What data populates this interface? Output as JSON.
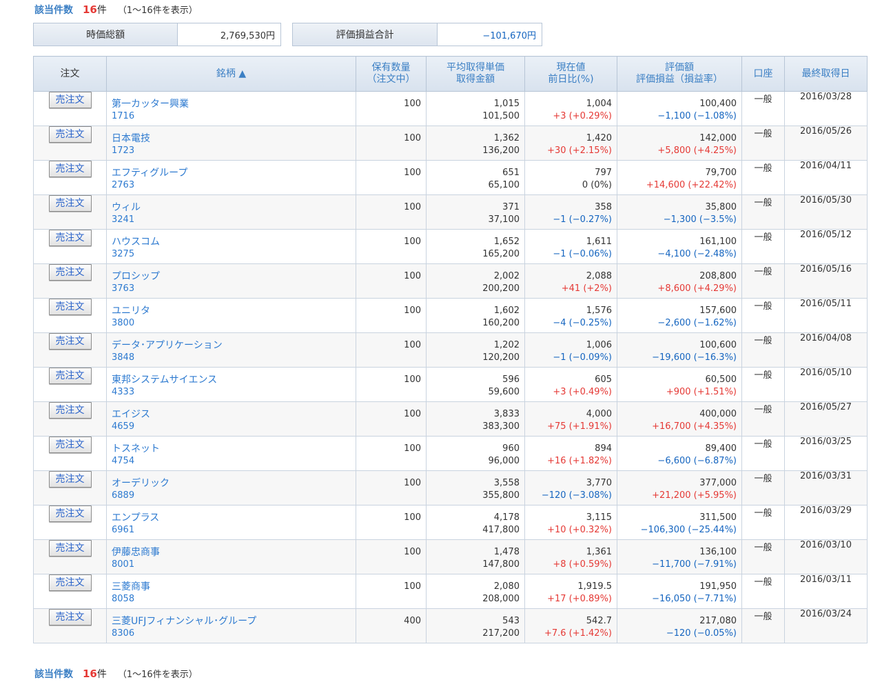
{
  "header": {
    "count_label": "該当件数",
    "count_num": "16",
    "count_unit": "件",
    "range_text": "（1～16件を表示）"
  },
  "summary": {
    "market_value_label": "時価総額",
    "market_value": "2,769,530円",
    "pl_total_label": "評価損益合計",
    "pl_total": "−101,670円"
  },
  "table": {
    "headers": {
      "order": "注文",
      "name": "銘柄 ▲",
      "qty_1": "保有数量",
      "qty_2": "（注文中）",
      "avg_1": "平均取得単価",
      "avg_2": "取得金額",
      "price_1": "現在値",
      "price_2": "前日比(%)",
      "valuation_1": "評価額",
      "valuation_2": "評価損益（損益率）",
      "account": "口座",
      "last_date": "最終取得日"
    },
    "sell_label": "売注文",
    "rows": [
      {
        "name": "第一カッター興業",
        "code": "1716",
        "qty": "100",
        "avg": "1,015",
        "cost": "101,500",
        "price": "1,004",
        "change": "+3 (+0.29%)",
        "change_sign": "pos",
        "value": "100,400",
        "pl": "−1,100 (−1.08%)",
        "pl_sign": "neg",
        "account": "一般",
        "date": "2016/03/28"
      },
      {
        "name": "日本電技",
        "code": "1723",
        "qty": "100",
        "avg": "1,362",
        "cost": "136,200",
        "price": "1,420",
        "change": "+30 (+2.15%)",
        "change_sign": "pos",
        "value": "142,000",
        "pl": "+5,800 (+4.25%)",
        "pl_sign": "pos",
        "account": "一般",
        "date": "2016/05/26"
      },
      {
        "name": "エフティグループ",
        "code": "2763",
        "qty": "100",
        "avg": "651",
        "cost": "65,100",
        "price": "797",
        "change": "0 (0%)",
        "change_sign": "zero",
        "value": "79,700",
        "pl": "+14,600 (+22.42%)",
        "pl_sign": "pos",
        "account": "一般",
        "date": "2016/04/11"
      },
      {
        "name": "ウィル",
        "code": "3241",
        "qty": "100",
        "avg": "371",
        "cost": "37,100",
        "price": "358",
        "change": "−1 (−0.27%)",
        "change_sign": "neg",
        "value": "35,800",
        "pl": "−1,300 (−3.5%)",
        "pl_sign": "neg",
        "account": "一般",
        "date": "2016/05/30"
      },
      {
        "name": "ハウスコム",
        "code": "3275",
        "qty": "100",
        "avg": "1,652",
        "cost": "165,200",
        "price": "1,611",
        "change": "−1 (−0.06%)",
        "change_sign": "neg",
        "value": "161,100",
        "pl": "−4,100 (−2.48%)",
        "pl_sign": "neg",
        "account": "一般",
        "date": "2016/05/12"
      },
      {
        "name": "プロシップ",
        "code": "3763",
        "qty": "100",
        "avg": "2,002",
        "cost": "200,200",
        "price": "2,088",
        "change": "+41 (+2%)",
        "change_sign": "pos",
        "value": "208,800",
        "pl": "+8,600 (+4.29%)",
        "pl_sign": "pos",
        "account": "一般",
        "date": "2016/05/16"
      },
      {
        "name": "ユニリタ",
        "code": "3800",
        "qty": "100",
        "avg": "1,602",
        "cost": "160,200",
        "price": "1,576",
        "change": "−4 (−0.25%)",
        "change_sign": "neg",
        "value": "157,600",
        "pl": "−2,600 (−1.62%)",
        "pl_sign": "neg",
        "account": "一般",
        "date": "2016/05/11"
      },
      {
        "name": "データ･アプリケーション",
        "code": "3848",
        "qty": "100",
        "avg": "1,202",
        "cost": "120,200",
        "price": "1,006",
        "change": "−1 (−0.09%)",
        "change_sign": "neg",
        "value": "100,600",
        "pl": "−19,600 (−16.3%)",
        "pl_sign": "neg",
        "account": "一般",
        "date": "2016/04/08"
      },
      {
        "name": "東邦システムサイエンス",
        "code": "4333",
        "qty": "100",
        "avg": "596",
        "cost": "59,600",
        "price": "605",
        "change": "+3 (+0.49%)",
        "change_sign": "pos",
        "value": "60,500",
        "pl": "+900 (+1.51%)",
        "pl_sign": "pos",
        "account": "一般",
        "date": "2016/05/10"
      },
      {
        "name": "エイジス",
        "code": "4659",
        "qty": "100",
        "avg": "3,833",
        "cost": "383,300",
        "price": "4,000",
        "change": "+75 (+1.91%)",
        "change_sign": "pos",
        "value": "400,000",
        "pl": "+16,700 (+4.35%)",
        "pl_sign": "pos",
        "account": "一般",
        "date": "2016/05/27"
      },
      {
        "name": "トスネット",
        "code": "4754",
        "qty": "100",
        "avg": "960",
        "cost": "96,000",
        "price": "894",
        "change": "+16 (+1.82%)",
        "change_sign": "pos",
        "value": "89,400",
        "pl": "−6,600 (−6.87%)",
        "pl_sign": "neg",
        "account": "一般",
        "date": "2016/03/25"
      },
      {
        "name": "オーデリック",
        "code": "6889",
        "qty": "100",
        "avg": "3,558",
        "cost": "355,800",
        "price": "3,770",
        "change": "−120 (−3.08%)",
        "change_sign": "neg",
        "value": "377,000",
        "pl": "+21,200 (+5.95%)",
        "pl_sign": "pos",
        "account": "一般",
        "date": "2016/03/31"
      },
      {
        "name": "エンプラス",
        "code": "6961",
        "qty": "100",
        "avg": "4,178",
        "cost": "417,800",
        "price": "3,115",
        "change": "+10 (+0.32%)",
        "change_sign": "pos",
        "value": "311,500",
        "pl": "−106,300 (−25.44%)",
        "pl_sign": "neg",
        "account": "一般",
        "date": "2016/03/29"
      },
      {
        "name": "伊藤忠商事",
        "code": "8001",
        "qty": "100",
        "avg": "1,478",
        "cost": "147,800",
        "price": "1,361",
        "change": "+8 (+0.59%)",
        "change_sign": "pos",
        "value": "136,100",
        "pl": "−11,700 (−7.91%)",
        "pl_sign": "neg",
        "account": "一般",
        "date": "2016/03/10"
      },
      {
        "name": "三菱商事",
        "code": "8058",
        "qty": "100",
        "avg": "2,080",
        "cost": "208,000",
        "price": "1,919.5",
        "change": "+17 (+0.89%)",
        "change_sign": "pos",
        "value": "191,950",
        "pl": "−16,050 (−7.71%)",
        "pl_sign": "neg",
        "account": "一般",
        "date": "2016/03/11"
      },
      {
        "name": "三菱UFJフィナンシャル･グループ",
        "code": "8306",
        "qty": "400",
        "avg": "543",
        "cost": "217,200",
        "price": "542.7",
        "change": "+7.6 (+1.42%)",
        "change_sign": "pos",
        "value": "217,080",
        "pl": "−120 (−0.05%)",
        "pl_sign": "neg",
        "account": "一般",
        "date": "2016/03/24"
      }
    ]
  },
  "colors": {
    "link": "#2d7ad0",
    "positive": "#e53935",
    "negative": "#1565c0",
    "header_bg": "#dde5ef"
  }
}
